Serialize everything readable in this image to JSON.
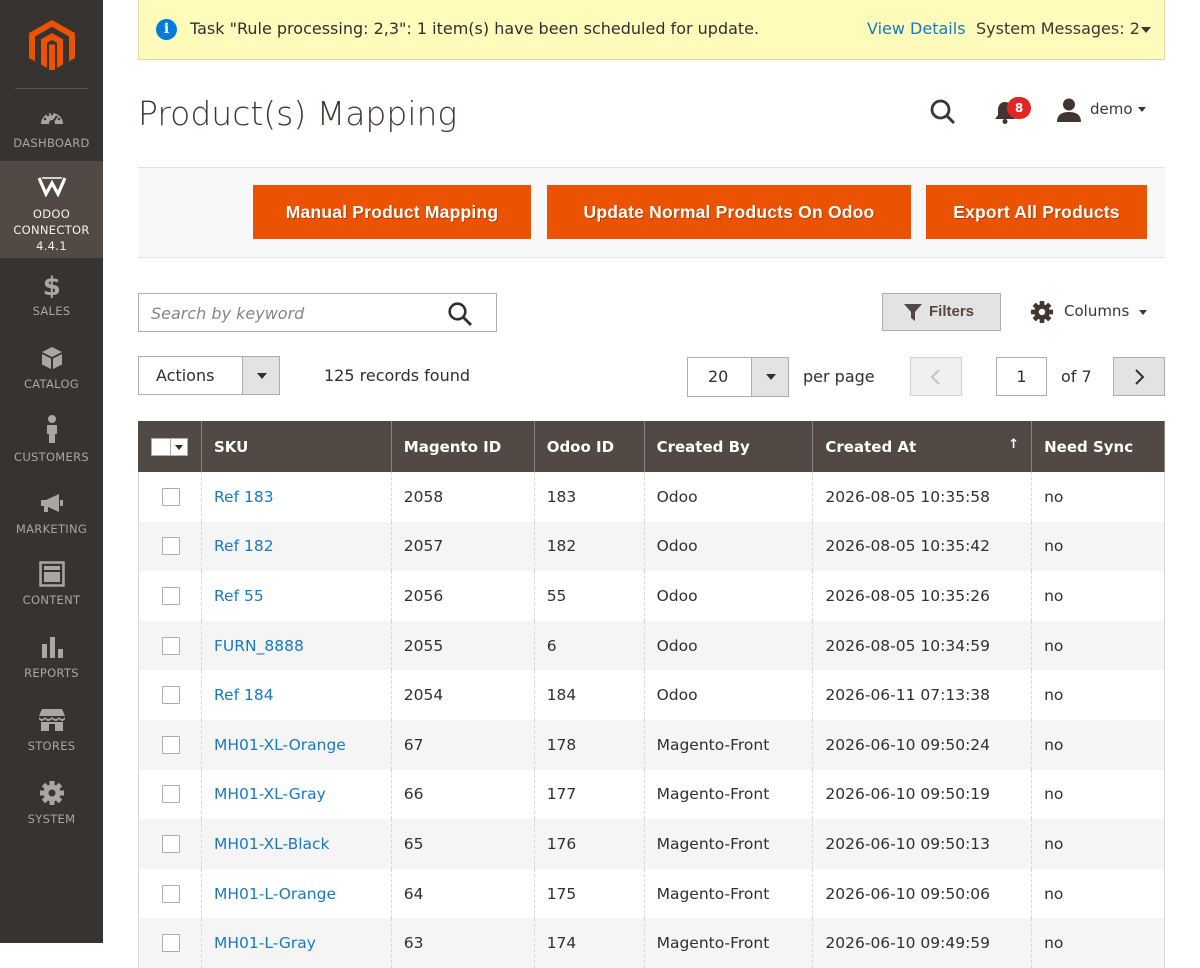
{
  "sidebar": {
    "items": [
      {
        "label": "Dashboard",
        "icon": "dashboard-icon"
      },
      {
        "label": "Odoo Connector 4.4.1",
        "label_lines": [
          "ODOO",
          "CONNECTOR",
          "4.4.1"
        ],
        "icon": "odoo-connector-icon",
        "active": true
      },
      {
        "label": "Sales",
        "icon": "dollar-icon"
      },
      {
        "label": "Catalog",
        "icon": "cube-icon"
      },
      {
        "label": "Customers",
        "icon": "person-icon"
      },
      {
        "label": "Marketing",
        "icon": "megaphone-icon"
      },
      {
        "label": "Content",
        "icon": "layout-icon"
      },
      {
        "label": "Reports",
        "icon": "bar-chart-icon"
      },
      {
        "label": "Stores",
        "icon": "storefront-icon"
      },
      {
        "label": "System",
        "icon": "gear-icon"
      }
    ]
  },
  "message": {
    "text": "Task \"Rule processing: 2,3\": 1 item(s) have been scheduled for update.",
    "link": "View Details",
    "system_messages": "System Messages: 2"
  },
  "header": {
    "title": "Product(s) Mapping",
    "notification_count": "8",
    "username": "demo"
  },
  "toolbar": {
    "buttons": [
      "Manual Product Mapping",
      "Update Normal Products On Odoo",
      "Export All Products"
    ]
  },
  "search": {
    "placeholder": "Search by keyword"
  },
  "filters_label": "Filters",
  "columns_label": "Columns",
  "actions_label": "Actions",
  "records_found": "125 records found",
  "pager": {
    "per_page": "20",
    "per_page_label": "per page",
    "current_page": "1",
    "of_pages": "of 7"
  },
  "grid": {
    "columns": [
      "SKU",
      "Magento ID",
      "Odoo ID",
      "Created By",
      "Created At",
      "Need Sync"
    ],
    "sort_indicator": "↑",
    "rows": [
      {
        "sku": "Ref 183",
        "magento_id": "2058",
        "odoo_id": "183",
        "created_by": "Odoo",
        "created_at": "2026-08-05 10:35:58",
        "need_sync": "no"
      },
      {
        "sku": "Ref 182",
        "magento_id": "2057",
        "odoo_id": "182",
        "created_by": "Odoo",
        "created_at": "2026-08-05 10:35:42",
        "need_sync": "no"
      },
      {
        "sku": "Ref 55",
        "magento_id": "2056",
        "odoo_id": "55",
        "created_by": "Odoo",
        "created_at": "2026-08-05 10:35:26",
        "need_sync": "no"
      },
      {
        "sku": "FURN_8888",
        "magento_id": "2055",
        "odoo_id": "6",
        "created_by": "Odoo",
        "created_at": "2026-08-05 10:34:59",
        "need_sync": "no"
      },
      {
        "sku": "Ref 184",
        "magento_id": "2054",
        "odoo_id": "184",
        "created_by": "Odoo",
        "created_at": "2026-06-11 07:13:38",
        "need_sync": "no"
      },
      {
        "sku": "MH01-XL-Orange",
        "magento_id": "67",
        "odoo_id": "178",
        "created_by": "Magento-Front",
        "created_at": "2026-06-10 09:50:24",
        "need_sync": "no"
      },
      {
        "sku": "MH01-XL-Gray",
        "magento_id": "66",
        "odoo_id": "177",
        "created_by": "Magento-Front",
        "created_at": "2026-06-10 09:50:19",
        "need_sync": "no"
      },
      {
        "sku": "MH01-XL-Black",
        "magento_id": "65",
        "odoo_id": "176",
        "created_by": "Magento-Front",
        "created_at": "2026-06-10 09:50:13",
        "need_sync": "no"
      },
      {
        "sku": "MH01-L-Orange",
        "magento_id": "64",
        "odoo_id": "175",
        "created_by": "Magento-Front",
        "created_at": "2026-06-10 09:50:06",
        "need_sync": "no"
      },
      {
        "sku": "MH01-L-Gray",
        "magento_id": "63",
        "odoo_id": "174",
        "created_by": "Magento-Front",
        "created_at": "2026-06-10 09:49:59",
        "need_sync": "no"
      }
    ]
  },
  "colors": {
    "sidebar_bg": "#373330",
    "sidebar_active": "#514943",
    "accent": "#eb5202",
    "link": "#1979c3",
    "grid_header": "#514943",
    "message_bg": "#fffbbb",
    "badge": "#e22626"
  }
}
